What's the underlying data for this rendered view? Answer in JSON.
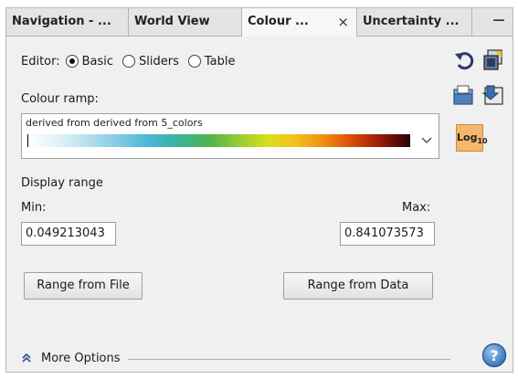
{
  "tabs": [
    {
      "label": "Navigation - ...",
      "active": false
    },
    {
      "label": "World View",
      "active": false
    },
    {
      "label": "Colour ...",
      "active": true,
      "close": "×"
    },
    {
      "label": "Uncertainty ...",
      "active": false
    }
  ],
  "minimize_label": "—",
  "editor": {
    "label": "Editor:",
    "options": [
      {
        "label": "Basic",
        "checked": true
      },
      {
        "label": "Sliders",
        "checked": false
      },
      {
        "label": "Table",
        "checked": false
      }
    ]
  },
  "colour_ramp": {
    "label": "Colour ramp:",
    "selected": "derived from derived from 5_colors"
  },
  "log_button": {
    "base": "Log",
    "sub": "10"
  },
  "display_range": {
    "heading": "Display range",
    "min_label": "Min:",
    "max_label": "Max:",
    "min_value": "0.049213043",
    "max_value": "0.841073573"
  },
  "buttons": {
    "range_from_file": "Range from File",
    "range_from_data": "Range from Data"
  },
  "more_options": {
    "label": "More Options",
    "icon": "double-chevron-up-icon"
  },
  "colors": {
    "active_tab": "#f7f7f7",
    "log_button": "#f6b66b",
    "help": "#2f6fb5"
  }
}
